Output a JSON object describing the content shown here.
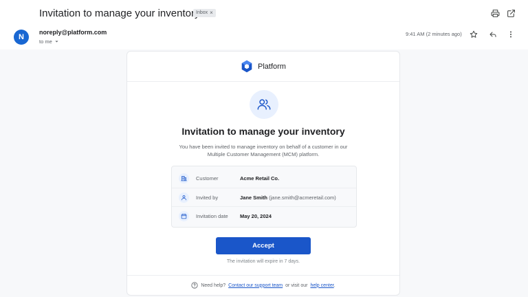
{
  "header": {
    "subject": "Invitation to manage your inventory",
    "label_chip": "Inbox",
    "label_chip_close": "×",
    "icons": [
      "print-icon",
      "open-in-new-window-icon"
    ]
  },
  "sender": {
    "avatar_initial": "N",
    "email": "noreply@platform.com",
    "recipient": "to me",
    "time": "9:41 AM (2 minutes ago)",
    "icons": [
      "star-icon",
      "reply-icon",
      "more-vertical-icon"
    ]
  },
  "email": {
    "brand_name": "Platform",
    "title": "Invitation to manage your inventory",
    "description": "You have been invited to manage inventory on behalf of a customer in our Multiple Customer Management (MCM) platform.",
    "details": [
      {
        "icon": "building-icon",
        "label": "Customer",
        "value": "Acme Retail Co.",
        "extra": ""
      },
      {
        "icon": "user-icon",
        "label": "Invited by",
        "value": "Jane Smith",
        "extra": "(jane.smith@acmeretail.com)"
      },
      {
        "icon": "calendar-icon",
        "label": "Invitation date",
        "value": "May 20, 2024",
        "extra": ""
      }
    ],
    "accept_label": "Accept",
    "expiry_note": "The invitation will expire in 7 days.",
    "footer": {
      "prefix": "Need help?",
      "support_link": "Contact our support team",
      "middle": "or visit our",
      "help_link": "help center",
      "suffix": "."
    }
  },
  "colors": {
    "accent": "#1a56c9",
    "avatar": "#1967d2",
    "icon_bg": "#e8f0fe"
  }
}
